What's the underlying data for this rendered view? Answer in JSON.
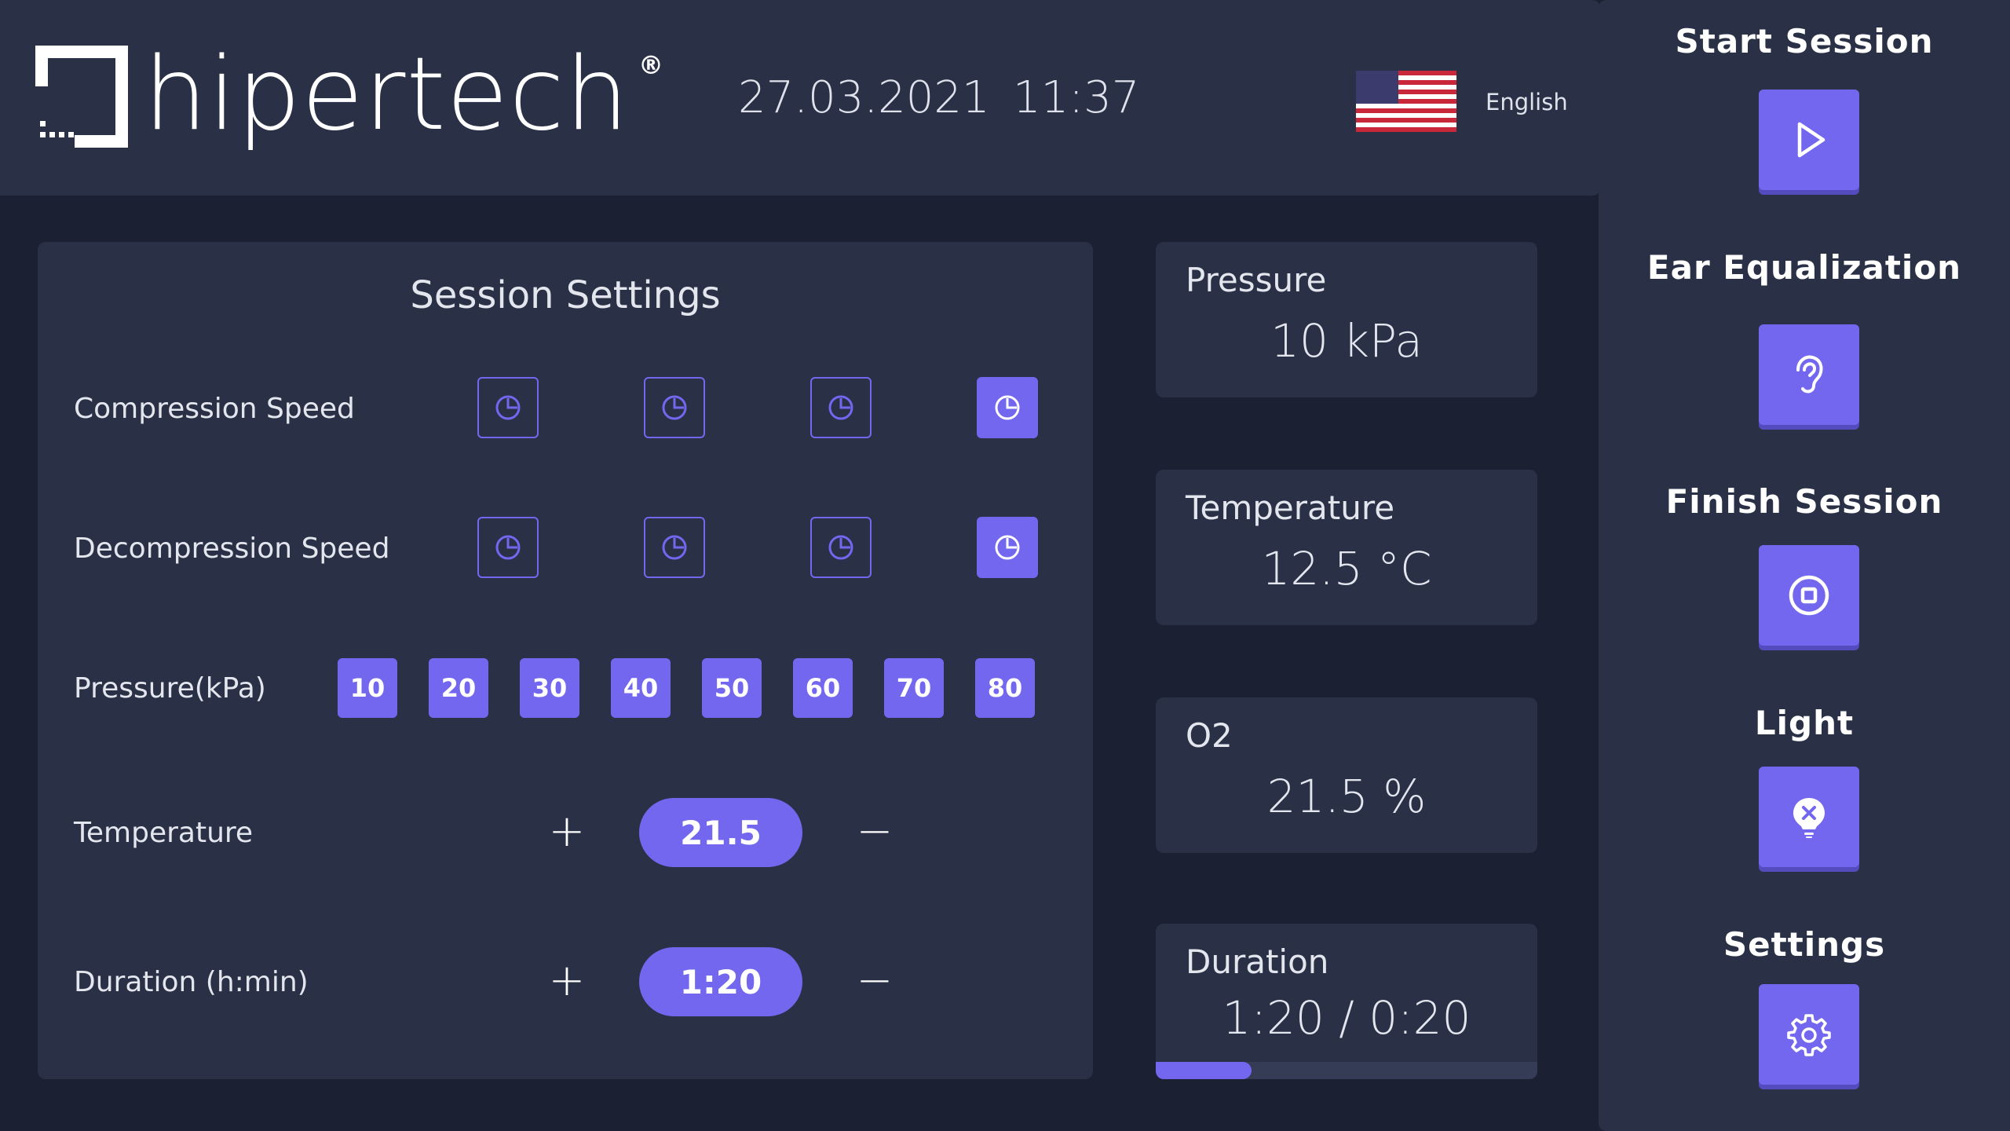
{
  "header": {
    "brand": "hipertech",
    "brand_reg": "®",
    "date": "27.03.2021",
    "time": "11:37",
    "language": "English",
    "flag_icon": "us-flag-icon"
  },
  "sidebar": {
    "items": [
      {
        "label": "Start Session",
        "icon": "play-icon"
      },
      {
        "label": "Ear Equalization",
        "icon": "ear-icon"
      },
      {
        "label": "Finish Session",
        "icon": "stop-icon"
      },
      {
        "label": "Light",
        "icon": "bulb-off-icon"
      },
      {
        "label": "Settings",
        "icon": "gear-icon"
      }
    ]
  },
  "settings": {
    "title": "Session Settings",
    "compression_label": "Compression Speed",
    "decompression_label": "Decompression Speed",
    "compression_selected": 4,
    "decompression_selected": 4,
    "pressure_label": "Pressure(kPa)",
    "pressure_options": [
      "10",
      "20",
      "30",
      "40",
      "50",
      "60",
      "70",
      "80"
    ],
    "temperature_label": "Temperature",
    "temperature_value": "21.5",
    "duration_label": "Duration (h:min)",
    "duration_value": "1:20",
    "plus": "+",
    "minus": "−"
  },
  "status": {
    "pressure": {
      "label": "Pressure",
      "value": "10 kPa"
    },
    "temperature": {
      "label": "Temperature",
      "value": "12.5 °C"
    },
    "o2": {
      "label": "O2",
      "value": "21.5 %"
    },
    "duration": {
      "label": "Duration",
      "value": "1:20 / 0:20",
      "progress": 0.25
    }
  },
  "colors": {
    "accent": "#7367f0",
    "panel": "#2a3146",
    "background": "#1b2133"
  }
}
